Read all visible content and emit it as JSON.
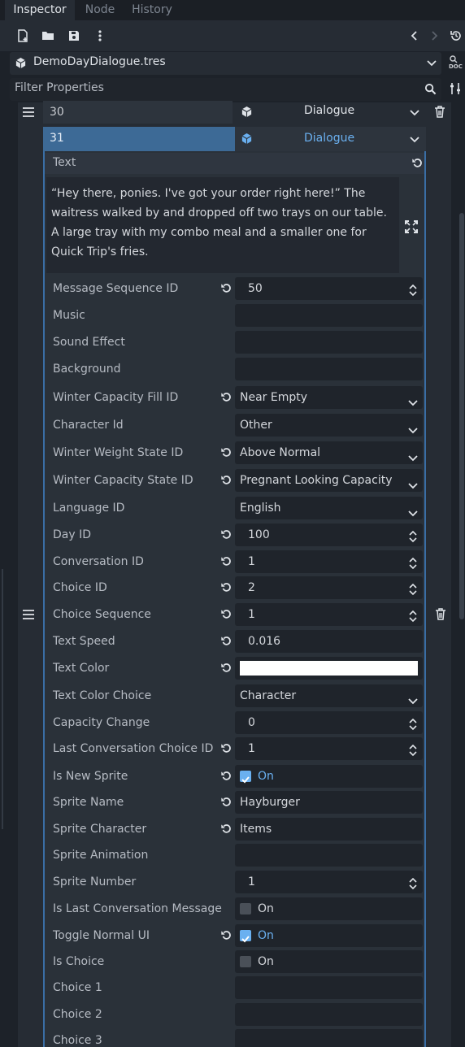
{
  "tabs": [
    {
      "label": "Inspector",
      "active": true
    },
    {
      "label": "Node",
      "active": false
    },
    {
      "label": "History",
      "active": false
    }
  ],
  "toolbar": {
    "icons": [
      "new-resource-icon",
      "open-folder-icon",
      "save-icon",
      "more-vertical-icon",
      "back-icon",
      "forward-icon",
      "history-icon"
    ]
  },
  "resource": {
    "name": "DemoDayDialogue.tres",
    "doc_label": "DOC"
  },
  "filter": {
    "placeholder": "Filter Properties"
  },
  "array_items": [
    {
      "index": "30",
      "type": "Dialogue"
    },
    {
      "index": "31",
      "type": "Dialogue"
    }
  ],
  "text_section": {
    "label": "Text",
    "value": "“Hey there, ponies. I've got your order right here!” The waitress walked by and dropped off two trays on our table. A large tray with my combo meal and a smaller one for Quick Trip's fries."
  },
  "properties": [
    {
      "label": "Message Sequence ID",
      "value": "50",
      "kind": "spin",
      "revert": true
    },
    {
      "label": "Music",
      "value": "",
      "kind": "text",
      "revert": false
    },
    {
      "label": "Sound Effect",
      "value": "",
      "kind": "text",
      "revert": false
    },
    {
      "label": "Background",
      "value": "",
      "kind": "text",
      "revert": false
    },
    {
      "label": "Winter Capacity Fill ID",
      "value": "Near Empty",
      "kind": "select",
      "revert": true
    },
    {
      "label": "Character Id",
      "value": "Other",
      "kind": "select",
      "revert": false
    },
    {
      "label": "Winter Weight State ID",
      "value": "Above Normal",
      "kind": "select",
      "revert": true
    },
    {
      "label": "Winter Capacity State ID",
      "value": "Pregnant Looking Capacity",
      "kind": "select",
      "revert": true
    },
    {
      "label": "Language ID",
      "value": "English",
      "kind": "select",
      "revert": false
    },
    {
      "label": "Day ID",
      "value": "100",
      "kind": "spin",
      "revert": true
    },
    {
      "label": "Conversation ID",
      "value": "1",
      "kind": "spin",
      "revert": true
    },
    {
      "label": "Choice ID",
      "value": "2",
      "kind": "spin",
      "revert": true
    },
    {
      "label": "Choice Sequence",
      "value": "1",
      "kind": "spin",
      "revert": true
    },
    {
      "label": "Text Speed",
      "value": "0.016",
      "kind": "text",
      "revert": true
    },
    {
      "label": "Text Color",
      "value": "",
      "kind": "color",
      "revert": true,
      "color": "#ffffff"
    },
    {
      "label": "Text Color Choice",
      "value": "Character",
      "kind": "select",
      "revert": false
    },
    {
      "label": "Capacity Change",
      "value": "0",
      "kind": "spin",
      "revert": false
    },
    {
      "label": "Last Conversation Choice ID",
      "value": "1",
      "kind": "spin",
      "revert": true
    },
    {
      "label": "Is New Sprite",
      "value": "On",
      "kind": "check",
      "checked": true,
      "revert": true
    },
    {
      "label": "Sprite Name",
      "value": "Hayburger",
      "kind": "text",
      "revert": true
    },
    {
      "label": "Sprite Character",
      "value": "Items",
      "kind": "text",
      "revert": true
    },
    {
      "label": "Sprite Animation",
      "value": "",
      "kind": "text",
      "revert": false
    },
    {
      "label": "Sprite Number",
      "value": "1",
      "kind": "spin",
      "revert": false
    },
    {
      "label": "Is Last Conversation Message",
      "value": "On",
      "kind": "check",
      "checked": false,
      "revert": false
    },
    {
      "label": "Toggle Normal UI",
      "value": "On",
      "kind": "check",
      "checked": true,
      "revert": true
    },
    {
      "label": "Is Choice",
      "value": "On",
      "kind": "check",
      "checked": false,
      "revert": false
    },
    {
      "label": "Choice 1",
      "value": "",
      "kind": "text",
      "revert": false
    },
    {
      "label": "Choice 2",
      "value": "",
      "kind": "text",
      "revert": false
    },
    {
      "label": "Choice 3",
      "value": "",
      "kind": "text",
      "revert": false
    }
  ],
  "colors": {
    "accent": "#6ab0f0",
    "selected_row": "#3d6a96",
    "panel": "#262c34"
  }
}
